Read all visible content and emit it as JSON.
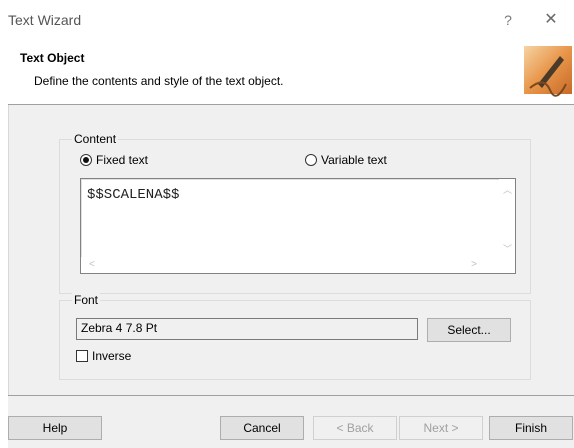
{
  "window": {
    "title": "Text Wizard",
    "help_label": "?",
    "close_label": "✕"
  },
  "header": {
    "title": "Text Object",
    "description": "Define the contents and style of the text object."
  },
  "content": {
    "group_label": "Content",
    "fixed_text_label": "Fixed text",
    "variable_text_label": "Variable text",
    "selected_option": "Fixed text",
    "text_value": "$$SCALENA$$"
  },
  "font": {
    "group_label": "Font",
    "value": "Zebra 4 7.8 Pt",
    "select_label": "Select...",
    "inverse_label": "Inverse",
    "inverse_checked": false
  },
  "buttons": {
    "help": "Help",
    "cancel": "Cancel",
    "back": "< Back",
    "next": "Next >",
    "finish": "Finish"
  }
}
